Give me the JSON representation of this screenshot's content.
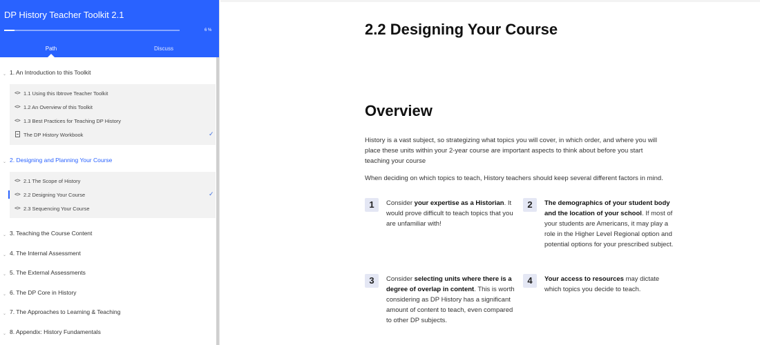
{
  "sidebar": {
    "title": "DP History Teacher Toolkit 2.1",
    "progress": {
      "percent_label": "6 %",
      "fraction": 0.06
    },
    "tabs": {
      "path": "Path",
      "discuss": "Discuss"
    },
    "sections": [
      {
        "label": "1. An Introduction to this Toolkit",
        "items": [
          {
            "label": "1.1 Using this Ibtrove Teacher Toolkit",
            "icon": "code-icon",
            "completed": false
          },
          {
            "label": "1.2 An Overview of this Toolkit",
            "icon": "code-icon",
            "completed": false
          },
          {
            "label": "1.3 Best Practices for Teaching DP History",
            "icon": "code-icon",
            "completed": false
          },
          {
            "label": "The DP History Workbook",
            "icon": "document-icon",
            "completed": true,
            "check": "✓"
          }
        ]
      },
      {
        "label": "2. Designing and Planning Your Course",
        "active": true,
        "items": [
          {
            "label": "2.1 The Scope of History",
            "icon": "code-icon",
            "completed": false
          },
          {
            "label": "2.2 Designing Your Course",
            "icon": "code-icon",
            "completed": true,
            "active": true,
            "check": "✓"
          },
          {
            "label": "2.3 Sequencing Your Course",
            "icon": "code-icon",
            "completed": false
          }
        ]
      },
      {
        "label": "3. Teaching the Course Content"
      },
      {
        "label": "4. The Internal Assessment"
      },
      {
        "label": "5. The External Assessments"
      },
      {
        "label": "6. The DP Core in History"
      },
      {
        "label": "7. The Approaches to Learning & Teaching"
      },
      {
        "label": "8. Appendix: History Fundamentals"
      }
    ]
  },
  "main": {
    "title": "2.2 Designing Your Course",
    "overview_heading": "Overview",
    "paragraphs": [
      "History is a vast subject, so strategizing what topics you will cover, in which order, and where you will place these units within your 2-year course are important aspects to think about before you start teaching your course",
      "When deciding on which topics to teach, History teachers should keep several different factors in mind."
    ],
    "factors": [
      {
        "number": "1",
        "pre": "Consider ",
        "bold": "your expertise as a Historian",
        "post": ". It would prove difficult to teach topics that you are unfamiliar with!"
      },
      {
        "number": "2",
        "pre": "",
        "bold": "The demographics of your student body and the location of your school",
        "post": ". If most of your students are Americans, it may play a role in the Higher Level Regional option and potential options for your prescribed subject."
      },
      {
        "number": "3",
        "pre": "Consider ",
        "bold": "selecting units where there is a degree of overlap in content",
        "post": ". This is worth considering as DP History has a significant amount of content to teach, even compared to other DP subjects."
      },
      {
        "number": "4",
        "pre": "",
        "bold": "Your access to resources",
        "post": " may dictate which topics you decide to teach."
      }
    ]
  },
  "colors": {
    "accent": "#2962ff",
    "check": "#3f6fe0",
    "badge_bg": "#e4e7f4"
  }
}
